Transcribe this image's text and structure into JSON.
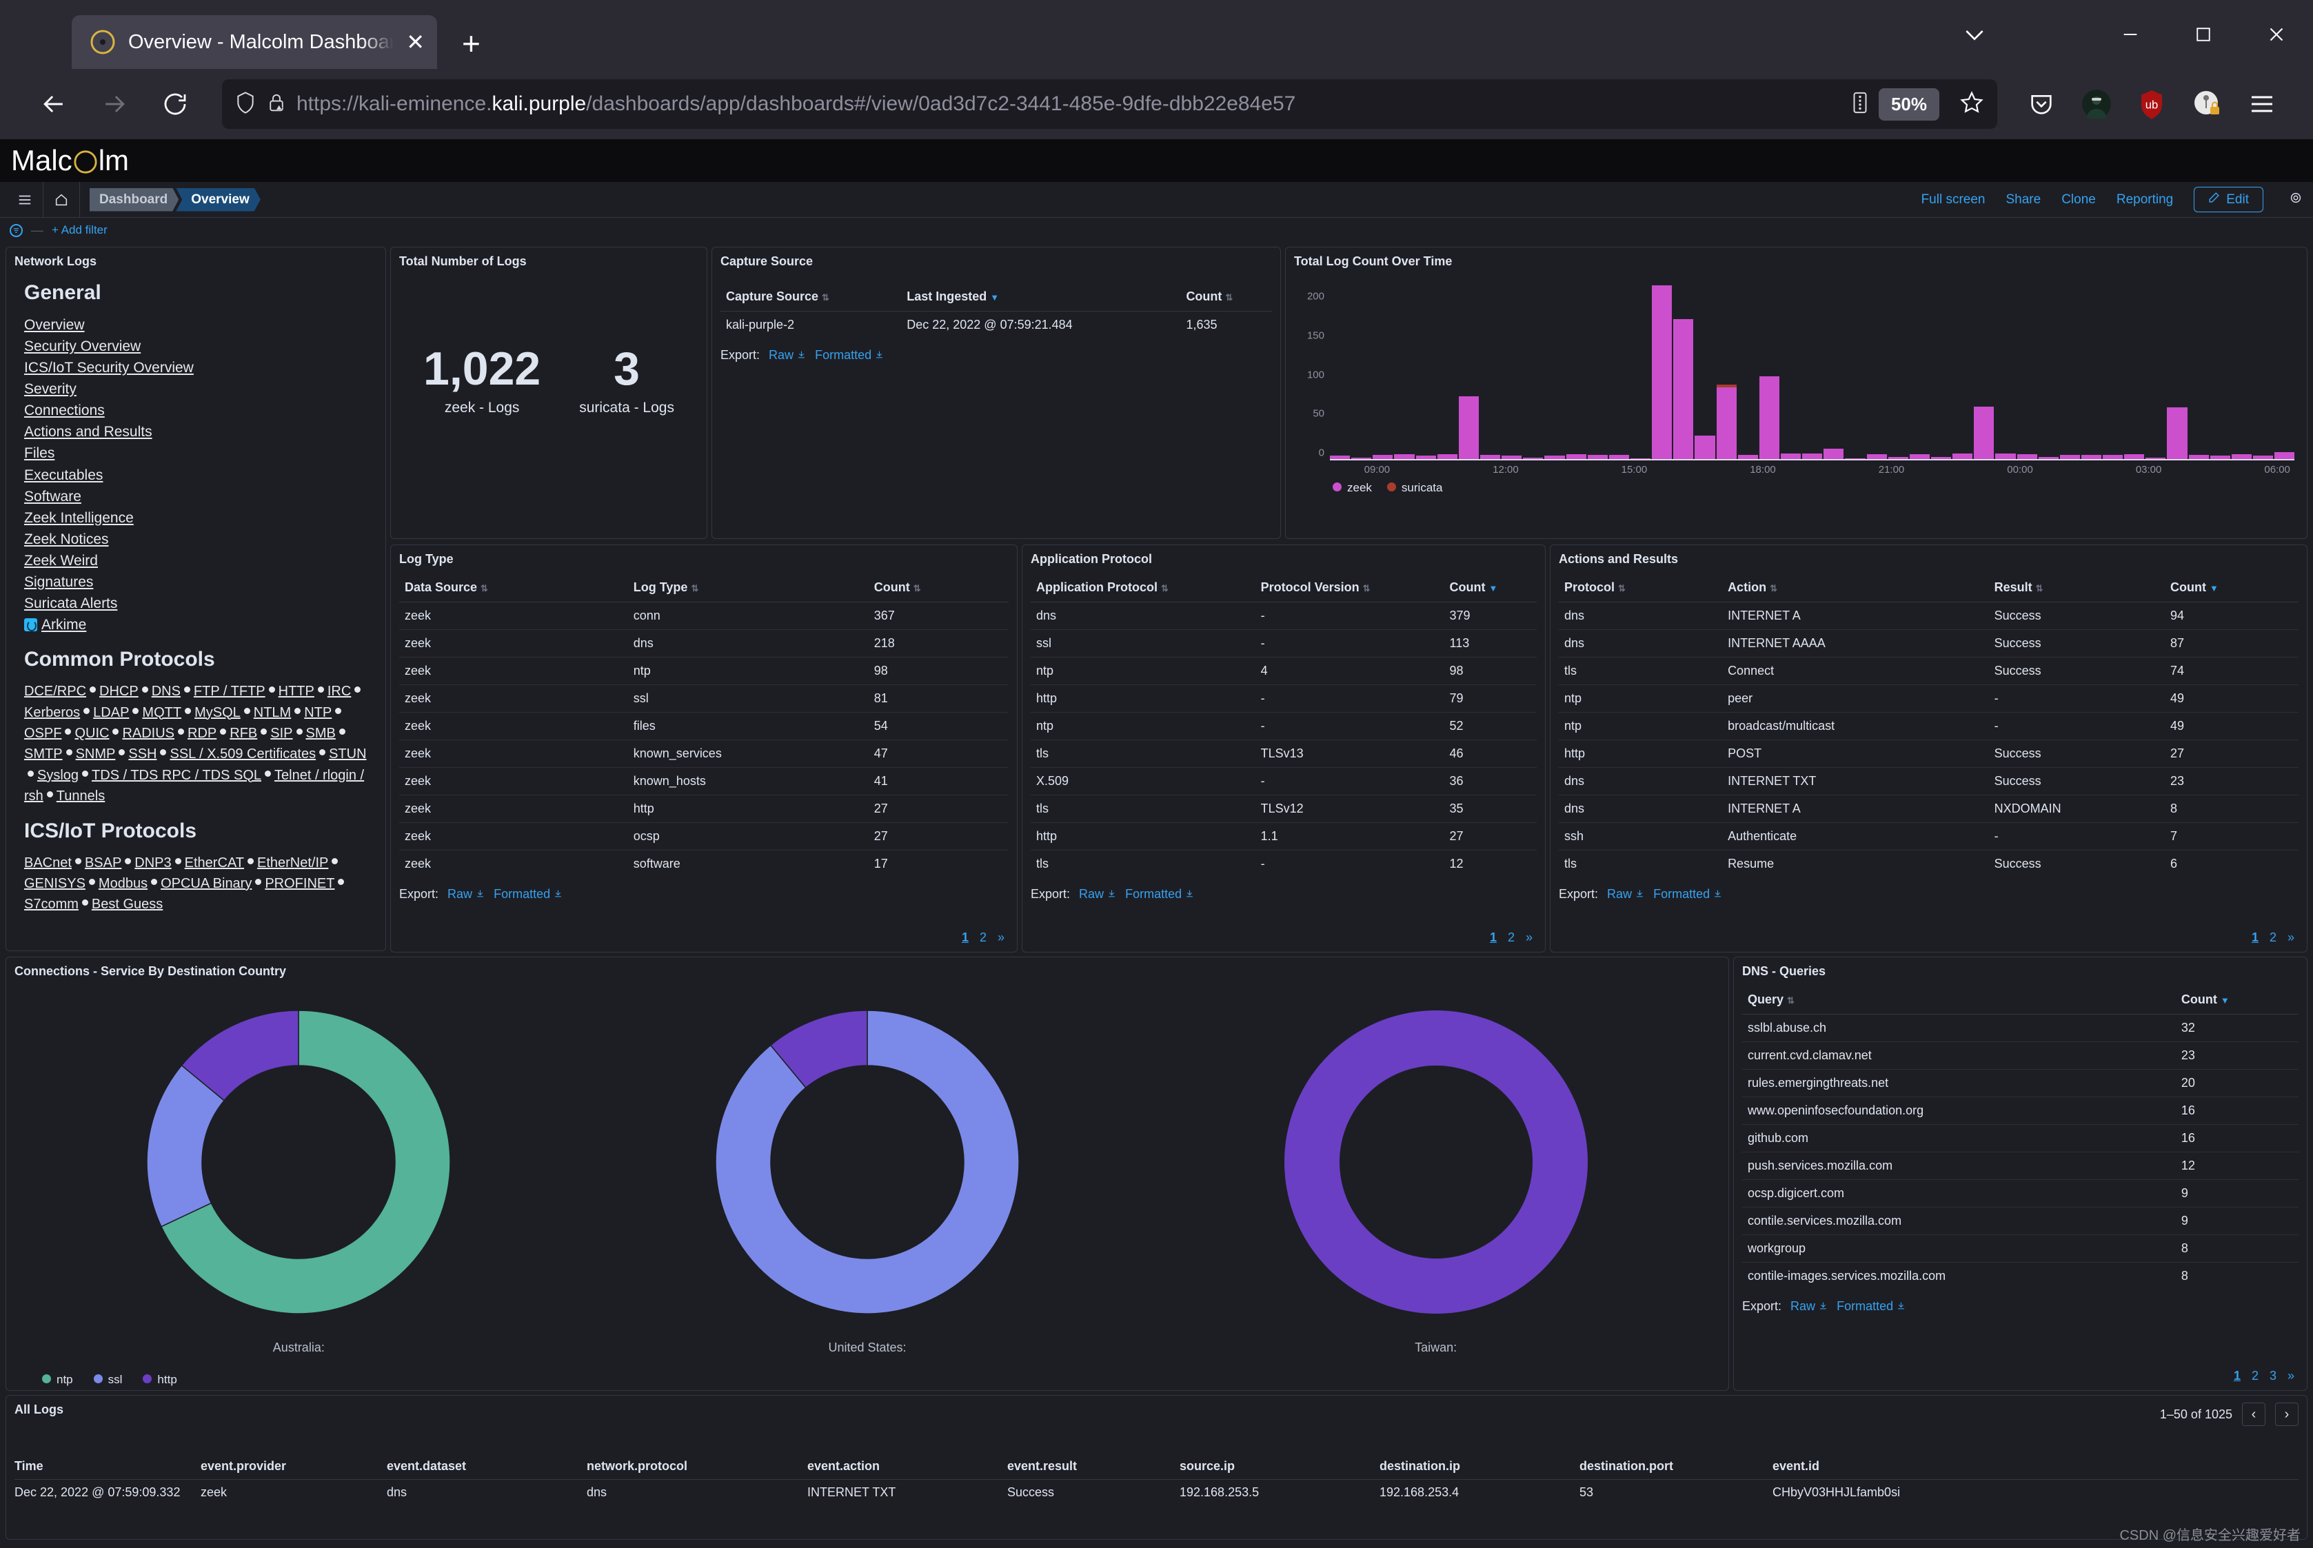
{
  "browser": {
    "tab_title": "Overview - Malcolm Dashboards",
    "tab_close": "✕",
    "new_tab": "+",
    "url_prefix": "https://kali-eminence.",
    "url_domain": "kali.purple",
    "url_suffix": "/dashboards/app/dashboards#/view/0ad3d7c2-3441-485e-9dfe-dbb22e84e57",
    "zoom_level": "50%",
    "window_minimize": "—",
    "window_maximize": "❐",
    "window_close": "✕",
    "tab_list_chevron": "⌄"
  },
  "app": {
    "logo_text_left": "Malc",
    "logo_text_right": "lm",
    "breadcrumb": [
      "Dashboard",
      "Overview"
    ],
    "toolbar_links": [
      "Full screen",
      "Share",
      "Clone",
      "Reporting"
    ],
    "edit_label": "Edit",
    "add_filter": "+ Add filter"
  },
  "nav_panel": {
    "title": "Network Logs",
    "general_heading": "General",
    "general_links": [
      "Overview",
      "Security Overview",
      "ICS/IoT Security Overview",
      "Severity",
      "Connections",
      "Actions and Results",
      "Files",
      "Executables",
      "Software",
      "Zeek Intelligence",
      "Zeek Notices",
      "Zeek Weird",
      "Signatures",
      "Suricata Alerts"
    ],
    "arkime_link": "Arkime",
    "common_heading": "Common Protocols",
    "common_protocols": [
      "DCE/RPC",
      "DHCP",
      "DNS",
      "FTP / TFTP",
      "HTTP",
      "IRC",
      "Kerberos",
      "LDAP",
      "MQTT",
      "MySQL",
      "NTLM",
      "NTP",
      "OSPF",
      "QUIC",
      "RADIUS",
      "RDP",
      "RFB",
      "SIP",
      "SMB",
      "SMTP",
      "SNMP",
      "SSH",
      "SSL / X.509 Certificates",
      "STUN",
      "Syslog",
      "TDS / TDS RPC / TDS SQL",
      "Telnet / rlogin / rsh",
      "Tunnels"
    ],
    "ics_heading": "ICS/IoT Protocols",
    "ics_protocols": [
      "BACnet",
      "BSAP",
      "DNP3",
      "EtherCAT",
      "EtherNet/IP",
      "GENISYS",
      "Modbus",
      "OPCUA Binary",
      "PROFINET",
      "S7comm",
      "Best Guess"
    ]
  },
  "total_logs": {
    "title": "Total Number of Logs",
    "metrics": [
      {
        "value": "1,022",
        "label": "zeek - Logs"
      },
      {
        "value": "3",
        "label": "suricata - Logs"
      }
    ]
  },
  "capture_source": {
    "title": "Capture Source",
    "columns": [
      "Capture Source",
      "Last Ingested",
      "Count"
    ],
    "rows": [
      [
        "kali-purple-2",
        "Dec 22, 2022 @ 07:59:21.484",
        "1,635"
      ]
    ],
    "export_label": "Export:",
    "export_raw": "Raw",
    "export_formatted": "Formatted"
  },
  "log_type": {
    "title": "Log Type",
    "columns": [
      "Data Source",
      "Log Type",
      "Count"
    ],
    "rows": [
      [
        "zeek",
        "conn",
        "367"
      ],
      [
        "zeek",
        "dns",
        "218"
      ],
      [
        "zeek",
        "ntp",
        "98"
      ],
      [
        "zeek",
        "ssl",
        "81"
      ],
      [
        "zeek",
        "files",
        "54"
      ],
      [
        "zeek",
        "known_services",
        "47"
      ],
      [
        "zeek",
        "known_hosts",
        "41"
      ],
      [
        "zeek",
        "http",
        "27"
      ],
      [
        "zeek",
        "ocsp",
        "27"
      ],
      [
        "zeek",
        "software",
        "17"
      ]
    ],
    "export_label": "Export:",
    "export_raw": "Raw",
    "export_formatted": "Formatted",
    "pages": [
      "1",
      "2",
      "»"
    ]
  },
  "application_protocol": {
    "title": "Application Protocol",
    "columns": [
      "Application Protocol",
      "Protocol Version",
      "Count"
    ],
    "rows": [
      [
        "dns",
        "-",
        "379"
      ],
      [
        "ssl",
        "-",
        "113"
      ],
      [
        "ntp",
        "4",
        "98"
      ],
      [
        "http",
        "-",
        "79"
      ],
      [
        "ntp",
        "-",
        "52"
      ],
      [
        "tls",
        "TLSv13",
        "46"
      ],
      [
        "X.509",
        "-",
        "36"
      ],
      [
        "tls",
        "TLSv12",
        "35"
      ],
      [
        "http",
        "1.1",
        "27"
      ],
      [
        "tls",
        "-",
        "12"
      ]
    ],
    "export_label": "Export:",
    "export_raw": "Raw",
    "export_formatted": "Formatted",
    "pages": [
      "1",
      "2",
      "»"
    ]
  },
  "actions_results": {
    "title": "Actions and Results",
    "columns": [
      "Protocol",
      "Action",
      "Result",
      "Count"
    ],
    "rows": [
      [
        "dns",
        "INTERNET A",
        "Success",
        "94"
      ],
      [
        "dns",
        "INTERNET AAAA",
        "Success",
        "87"
      ],
      [
        "tls",
        "Connect",
        "Success",
        "74"
      ],
      [
        "ntp",
        "peer",
        "-",
        "49"
      ],
      [
        "ntp",
        "broadcast/multicast",
        "-",
        "49"
      ],
      [
        "http",
        "POST",
        "Success",
        "27"
      ],
      [
        "dns",
        "INTERNET TXT",
        "Success",
        "23"
      ],
      [
        "dns",
        "INTERNET A",
        "NXDOMAIN",
        "8"
      ],
      [
        "ssh",
        "Authenticate",
        "-",
        "7"
      ],
      [
        "tls",
        "Resume",
        "Success",
        "6"
      ]
    ],
    "export_label": "Export:",
    "export_raw": "Raw",
    "export_formatted": "Formatted",
    "pages": [
      "1",
      "2",
      "»"
    ]
  },
  "dns_queries": {
    "title": "DNS - Queries",
    "columns": [
      "Query",
      "Count"
    ],
    "rows": [
      [
        "sslbl.abuse.ch",
        "32"
      ],
      [
        "current.cvd.clamav.net",
        "23"
      ],
      [
        "rules.emergingthreats.net",
        "20"
      ],
      [
        "www.openinfosecfoundation.org",
        "16"
      ],
      [
        "github.com",
        "16"
      ],
      [
        "push.services.mozilla.com",
        "12"
      ],
      [
        "ocsp.digicert.com",
        "9"
      ],
      [
        "contile.services.mozilla.com",
        "9"
      ],
      [
        "workgroup",
        "8"
      ],
      [
        "contile-images.services.mozilla.com",
        "8"
      ]
    ],
    "export_label": "Export:",
    "export_raw": "Raw",
    "export_formatted": "Formatted",
    "pages": [
      "1",
      "2",
      "3",
      "»"
    ]
  },
  "all_logs": {
    "title": "All Logs",
    "range_label": "1–50 of 1025",
    "prev": "‹",
    "next": "›",
    "columns": [
      "Time",
      "event.provider",
      "event.dataset",
      "network.protocol",
      "event.action",
      "event.result",
      "source.ip",
      "destination.ip",
      "destination.port",
      "event.id"
    ],
    "rows": [
      [
        "Dec 22, 2022 @ 07:59:09.332",
        "zeek",
        "dns",
        "dns",
        "INTERNET TXT",
        "Success",
        "192.168.253.5",
        "192.168.253.4",
        "53",
        "CHbyV03HHJLfamb0si"
      ]
    ]
  },
  "watermark": "CSDN @信息安全兴趣爱好者",
  "chart_data": [
    {
      "type": "bar",
      "title": "Total Log Count Over Time",
      "xlabel": "",
      "ylabel": "",
      "ylim": [
        0,
        240
      ],
      "yticks": [
        0,
        50,
        100,
        150,
        200
      ],
      "xticks": [
        "09:00",
        "12:00",
        "15:00",
        "18:00",
        "21:00",
        "00:00",
        "03:00",
        "06:00"
      ],
      "grid": false,
      "legend": [
        "zeek",
        "suricata"
      ],
      "legend_position": "bottom-left",
      "colors": {
        "zeek": "#cc4fce",
        "suricata": "#aa3c2e"
      },
      "series": [
        {
          "name": "zeek",
          "values": [
            4,
            2,
            5,
            6,
            4,
            6,
            80,
            5,
            4,
            2,
            4,
            6,
            5,
            5,
            1,
            222,
            179,
            30,
            92,
            5,
            106,
            7,
            7,
            13,
            1,
            6,
            3,
            6,
            3,
            7,
            67,
            7,
            6,
            3,
            5,
            5,
            5,
            6,
            2,
            66,
            5,
            4,
            6,
            4,
            9
          ]
        },
        {
          "name": "suricata",
          "values": [
            0,
            0,
            0,
            0,
            0,
            0,
            0,
            0,
            0,
            0,
            0,
            0,
            0,
            0,
            0,
            0,
            0,
            0,
            3,
            0,
            0,
            0,
            0,
            0,
            0,
            0,
            0,
            0,
            0,
            0,
            0,
            0,
            0,
            0,
            0,
            0,
            0,
            0,
            0,
            0,
            0,
            0,
            0,
            0,
            0
          ]
        }
      ]
    },
    {
      "type": "pie",
      "title": "Connections - Service By Destination Country",
      "subcharts": [
        {
          "label": "Australia:",
          "categories": [
            "ntp",
            "ssl",
            "http"
          ],
          "values": [
            68,
            18,
            14
          ]
        },
        {
          "label": "United States:",
          "categories": [
            "ssl",
            "http"
          ],
          "values": [
            89,
            11
          ]
        },
        {
          "label": "Taiwan:",
          "categories": [
            "http"
          ],
          "values": [
            100
          ]
        }
      ],
      "legend": [
        "ntp",
        "ssl",
        "http"
      ],
      "colors": {
        "ntp": "#54b399",
        "ssl": "#7b8ae8",
        "http": "#6a3fc4"
      }
    }
  ]
}
